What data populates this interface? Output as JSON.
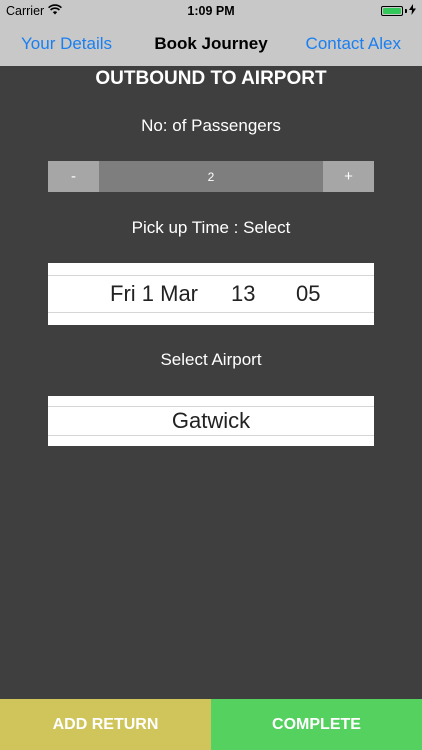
{
  "status_bar": {
    "carrier": "Carrier",
    "time": "1:09 PM",
    "wifi_icon": "wifi-icon",
    "battery_icon": "battery-icon",
    "battery_level": 1.0,
    "charging_icon": "bolt-icon"
  },
  "nav": {
    "left": "Your Details",
    "title": "Book Journey",
    "right": "Contact Alex",
    "link_color": "#1a7ff0"
  },
  "main": {
    "section_title": "OUTBOUND TO AIRPORT",
    "passengers_label": "No: of Passengers",
    "stepper": {
      "minus": "-",
      "value": "2",
      "plus": "+"
    },
    "pickup_label": "Pick up Time : Select",
    "pickup": {
      "date": "Fri 1 Mar",
      "hour": "13",
      "minute": "05"
    },
    "airport_label": "Select Airport",
    "airport": "Gatwick"
  },
  "bottom": {
    "add_return": "ADD RETURN",
    "complete": "COMPLETE",
    "add_return_color": "#cfc55a",
    "complete_color": "#55d15f"
  }
}
